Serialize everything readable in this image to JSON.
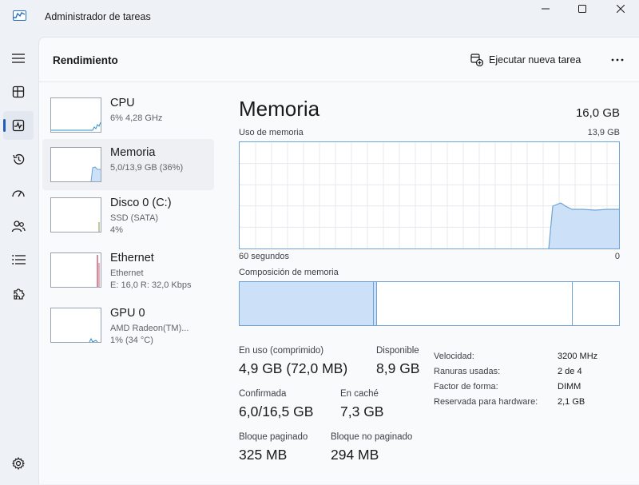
{
  "window": {
    "title": "Administrador de tareas"
  },
  "nav": {
    "items": [
      "hamburger-menu",
      "processes",
      "performance",
      "app-history",
      "startup-apps",
      "users",
      "details",
      "services",
      "settings"
    ],
    "active": "performance"
  },
  "header": {
    "title": "Rendimiento",
    "run_task_label": "Ejecutar nueva tarea"
  },
  "sidebar": {
    "items": [
      {
        "name": "CPU",
        "line1": "6% 4,28 GHz",
        "line2": "",
        "line3": ""
      },
      {
        "name": "Memoria",
        "line1": "5,0/13,9 GB (36%)",
        "line2": "",
        "line3": ""
      },
      {
        "name": "Disco 0 (C:)",
        "line1": "SSD (SATA)",
        "line2": "4%",
        "line3": ""
      },
      {
        "name": "Ethernet",
        "line1": "Ethernet",
        "line2": "E: 16,0 R: 32,0 Kbps",
        "line3": ""
      },
      {
        "name": "GPU 0",
        "line1": "AMD Radeon(TM)...",
        "line2": "1% (34 °C)",
        "line3": ""
      }
    ],
    "selected": "Memoria"
  },
  "memory": {
    "title": "Memoria",
    "total": "16,0 GB",
    "usage_label": "Uso de memoria",
    "usage_max": "13,9 GB",
    "axis_left": "60 segundos",
    "axis_right": "0",
    "composition_label": "Composición de memoria",
    "composition": {
      "in_use_fraction": 0.36,
      "modified_fraction": 0.01,
      "standby_fraction": 0.52,
      "free_fraction": 0.11
    },
    "stats": {
      "in_use_label": "En uso (comprimido)",
      "in_use_value": "4,9 GB (72,0 MB)",
      "available_label": "Disponible",
      "available_value": "8,9 GB",
      "committed_label": "Confirmada",
      "committed_value": "6,0/16,5 GB",
      "cached_label": "En caché",
      "cached_value": "7,3 GB",
      "paged_label": "Bloque paginado",
      "paged_value": "325 MB",
      "nonpaged_label": "Bloque no paginado",
      "nonpaged_value": "294 MB"
    },
    "details": [
      {
        "key": "Velocidad:",
        "value": "3200 MHz"
      },
      {
        "key": "Ranuras usadas:",
        "value": "2 de 4"
      },
      {
        "key": "Factor de forma:",
        "value": "DIMM"
      },
      {
        "key": "Reservada para hardware:",
        "value": "2,1 GB"
      }
    ]
  },
  "colors": {
    "accent": "#1f5fb8",
    "memory_line": "#6fa3d4",
    "memory_fill": "#cce0f7",
    "ethernet_line": "#c0385c"
  }
}
